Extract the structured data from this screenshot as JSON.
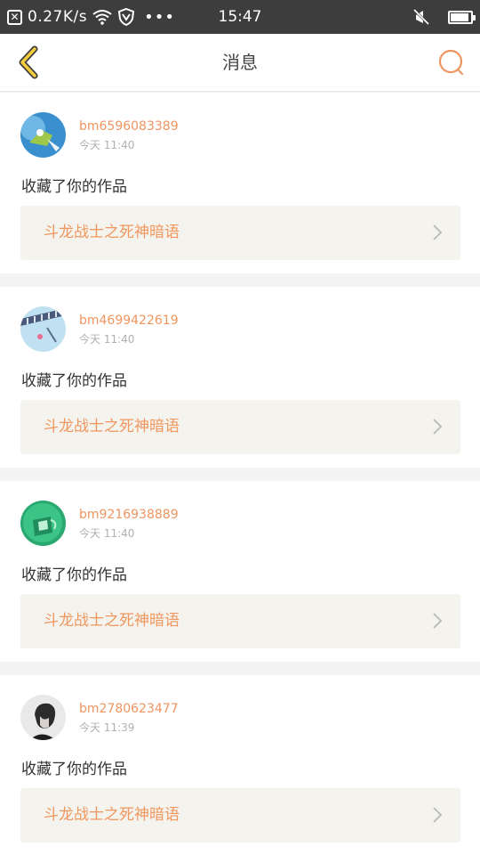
{
  "status_bar": {
    "speed": "0.27K/s",
    "time": "15:47",
    "icons": [
      "close-notification-icon",
      "wifi-icon",
      "vpn-shield-icon",
      "more-dots-icon",
      "mute-icon",
      "battery-icon"
    ],
    "battery_level": 0.9
  },
  "header": {
    "title": "消息",
    "back_icon": "chevron-left-icon",
    "search_icon": "search-icon"
  },
  "colors": {
    "accent": "#ee9560",
    "header_bg": "#ffffff",
    "status_bg": "#3d3d3d",
    "link_bg": "#f4f3ee"
  },
  "notifications": [
    {
      "username": "bm6596083389",
      "time": "今天 11:40",
      "action": "收藏了你的作品",
      "work_title": "斗龙战士之死神暗语"
    },
    {
      "username": "bm4699422619",
      "time": "今天 11:40",
      "action": "收藏了你的作品",
      "work_title": "斗龙战士之死神暗语"
    },
    {
      "username": "bm9216938889",
      "time": "今天 11:40",
      "action": "收藏了你的作品",
      "work_title": "斗龙战士之死神暗语"
    },
    {
      "username": "bm2780623477",
      "time": "今天 11:39",
      "action": "收藏了你的作品",
      "work_title": "斗龙战士之死神暗语"
    }
  ]
}
